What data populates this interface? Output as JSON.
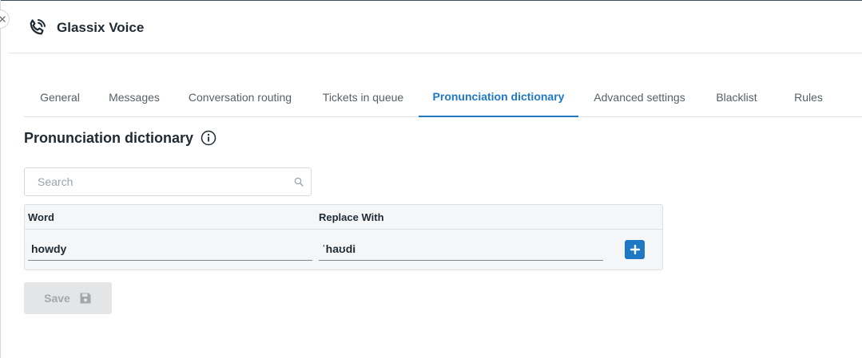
{
  "app": {
    "title": "Glassix Voice",
    "icon": "phone-icon"
  },
  "tabs": [
    {
      "label": "General",
      "active": false
    },
    {
      "label": "Messages",
      "active": false
    },
    {
      "label": "Conversation routing",
      "active": false
    },
    {
      "label": "Tickets in queue",
      "active": false
    },
    {
      "label": "Pronunciation dictionary",
      "active": true
    },
    {
      "label": "Advanced settings",
      "active": false
    },
    {
      "label": "Blacklist",
      "active": false
    },
    {
      "label": "Rules",
      "active": false
    }
  ],
  "section": {
    "title": "Pronunciation dictionary",
    "info_icon": "info-icon"
  },
  "search": {
    "placeholder": "Search",
    "value": ""
  },
  "table": {
    "columns": [
      "Word",
      "Replace With"
    ],
    "rows": [
      {
        "word": "howdy",
        "replace_with": "ˈhaʊdi"
      }
    ]
  },
  "save_button": {
    "label": "Save",
    "enabled": false
  },
  "colors": {
    "accent": "#1f78c4",
    "text": "#1f2a33",
    "muted_text": "#555f67",
    "disabled_bg": "#e4e5e6"
  }
}
